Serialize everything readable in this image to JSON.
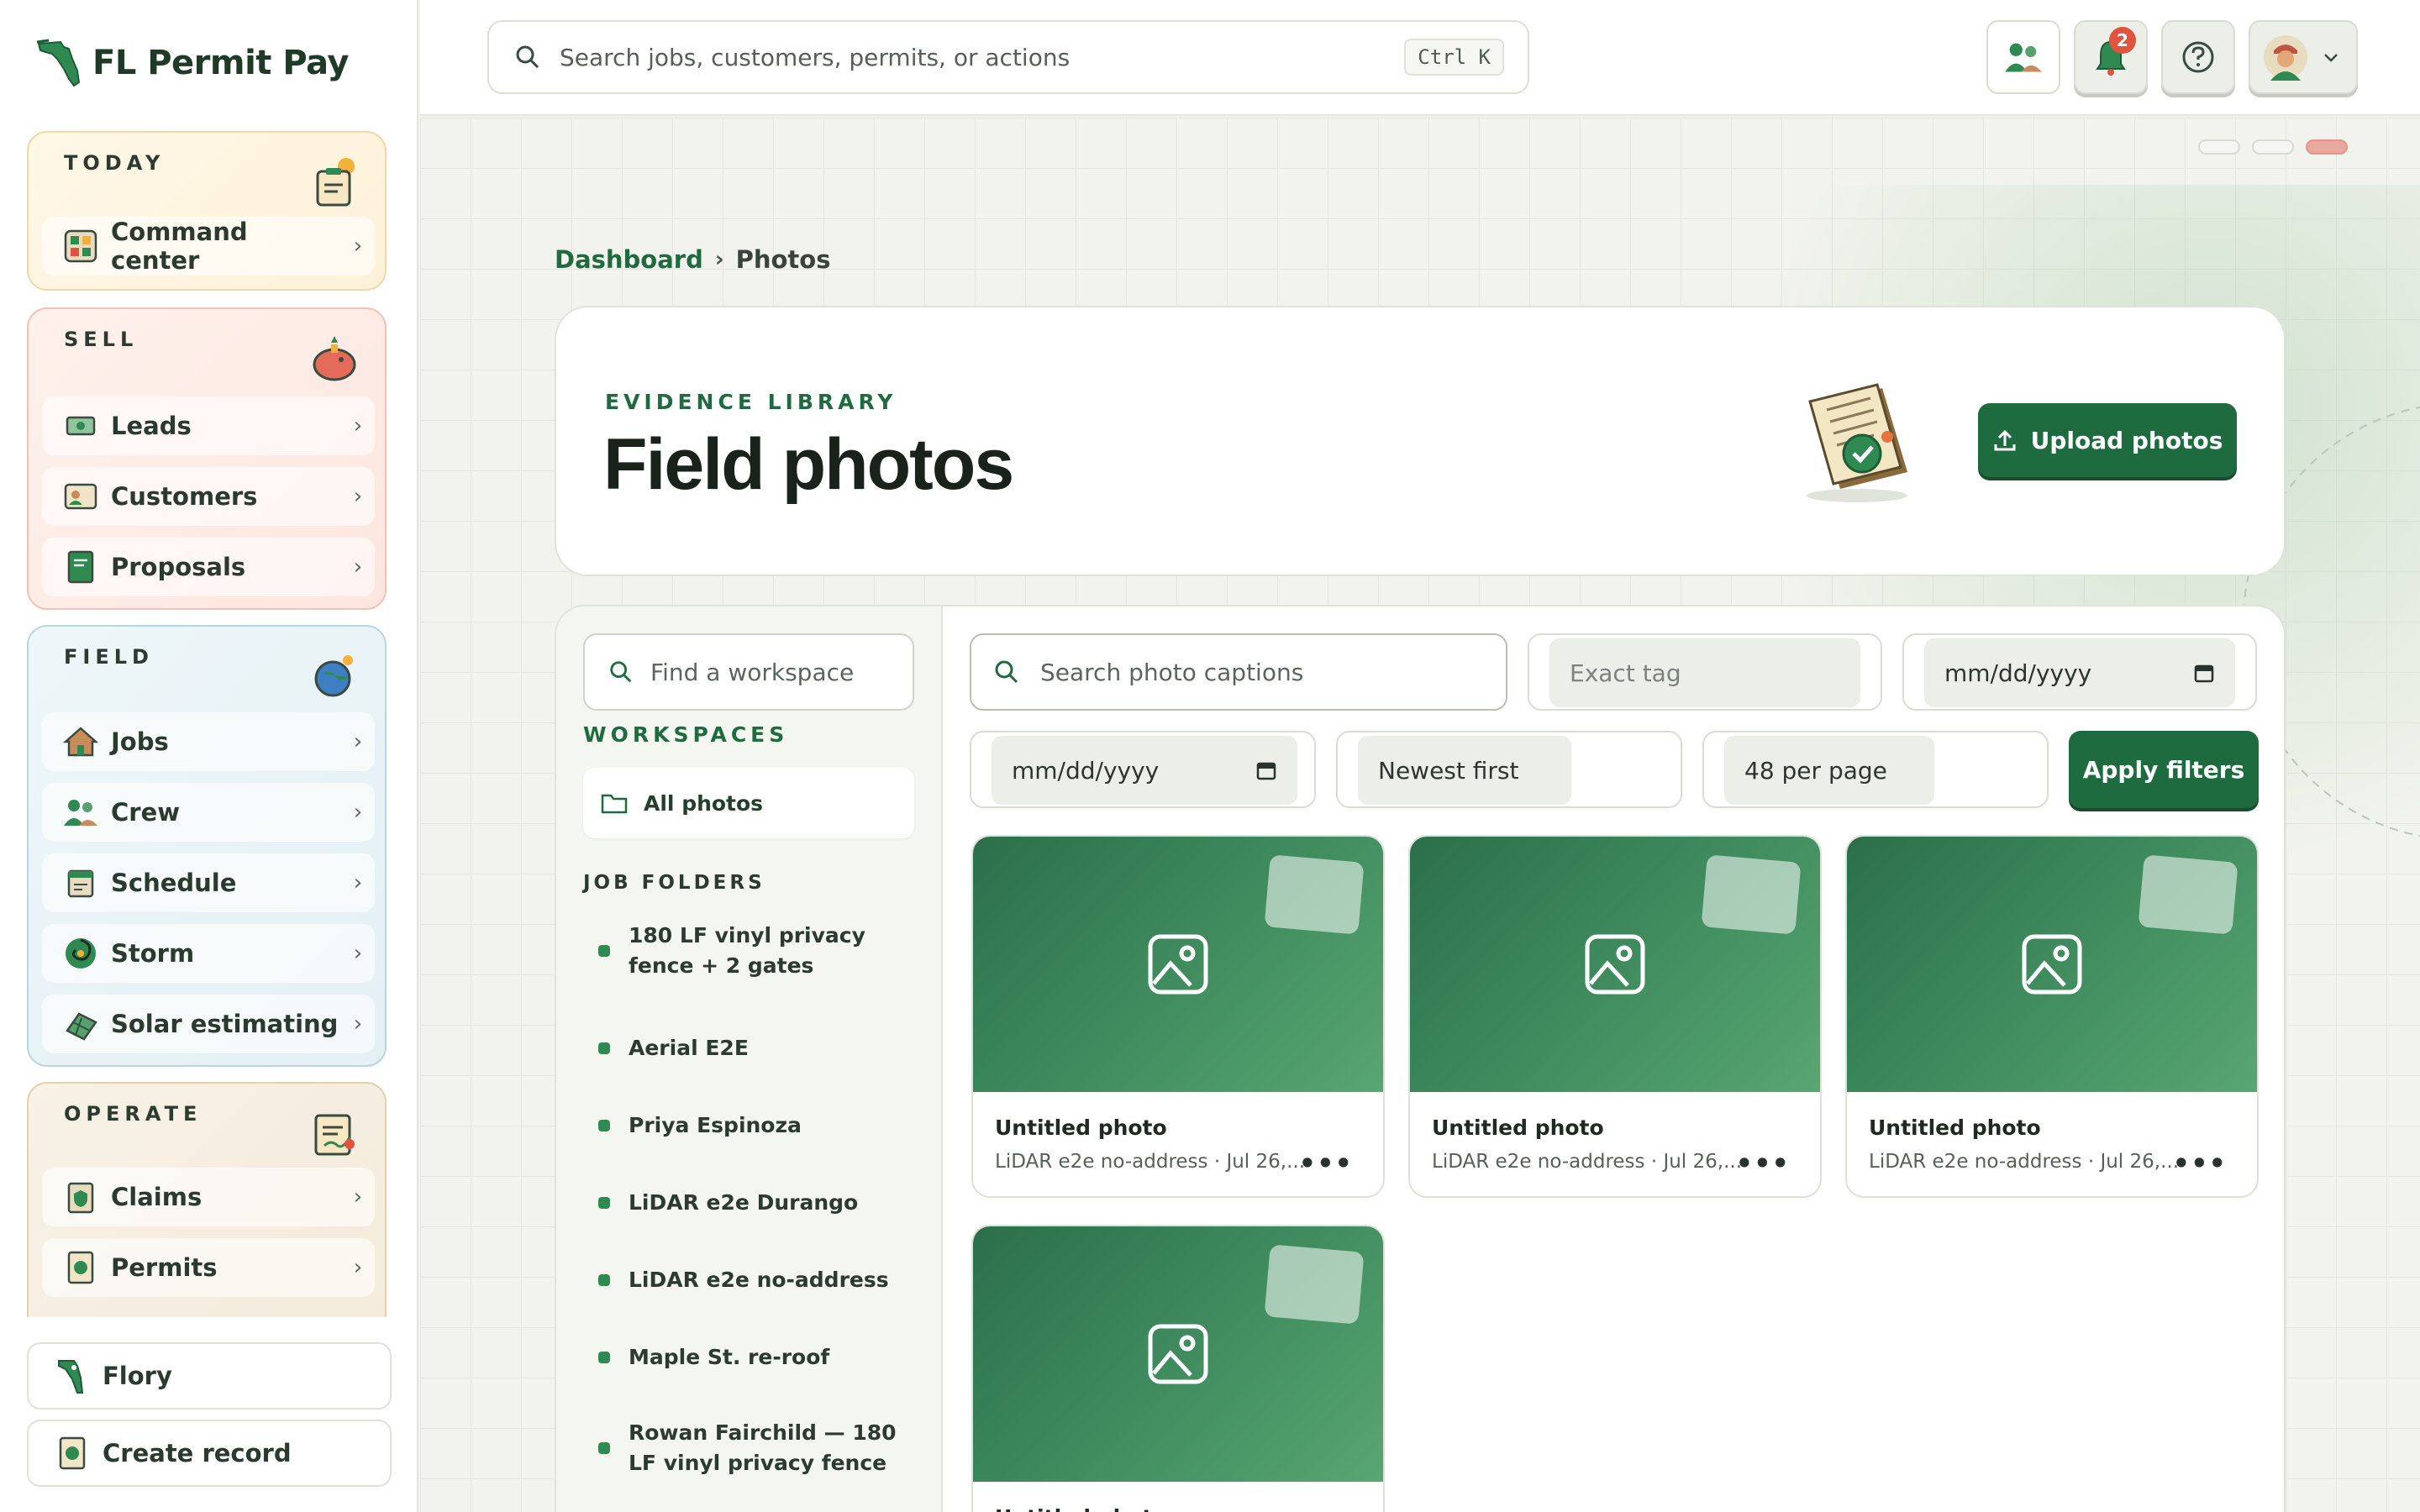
{
  "app": {
    "name": "FL Permit Pay"
  },
  "sidebar": {
    "sections": [
      {
        "title": "TODAY",
        "items": [
          {
            "label": "Command center"
          }
        ]
      },
      {
        "title": "SELL",
        "items": [
          {
            "label": "Leads"
          },
          {
            "label": "Customers"
          },
          {
            "label": "Proposals"
          }
        ]
      },
      {
        "title": "FIELD",
        "items": [
          {
            "label": "Jobs"
          },
          {
            "label": "Crew"
          },
          {
            "label": "Schedule"
          },
          {
            "label": "Storm"
          },
          {
            "label": "Solar estimating"
          }
        ]
      },
      {
        "title": "OPERATE",
        "items": [
          {
            "label": "Claims"
          },
          {
            "label": "Permits"
          }
        ]
      }
    ],
    "bottom": {
      "assistant": "Flory",
      "create": "Create record"
    }
  },
  "topbar": {
    "search_placeholder": "Search jobs, customers, permits, or actions",
    "shortcut": "Ctrl K",
    "notification_count": "2"
  },
  "breadcrumb": {
    "home": "Dashboard",
    "separator": "›",
    "current": "Photos"
  },
  "hero": {
    "eyebrow": "EVIDENCE LIBRARY",
    "title": "Field photos",
    "upload_label": "Upload photos"
  },
  "workspaces": {
    "search_placeholder": "Find a workspace",
    "heading": "WORKSPACES",
    "all_label": "All photos",
    "folders_heading": "JOB FOLDERS",
    "folders": [
      "180 LF vinyl privacy fence + 2 gates",
      "Aerial E2E",
      "Priya Espinoza",
      "LiDAR e2e Durango",
      "LiDAR e2e no-address",
      "Maple St. re-roof",
      "Rowan Fairchild — 180 LF vinyl privacy fence"
    ]
  },
  "filters": {
    "caption_placeholder": "Search photo captions",
    "tag_placeholder": "Exact tag",
    "date_from": "mm/dd/yyyy",
    "date_to": "mm/dd/yyyy",
    "sort": "Newest first",
    "per_page": "48 per page",
    "apply_label": "Apply filters"
  },
  "photos": [
    {
      "title": "Untitled photo",
      "subtitle": "LiDAR e2e no-address · Jul 26,..."
    },
    {
      "title": "Untitled photo",
      "subtitle": "LiDAR e2e no-address · Jul 26,..."
    },
    {
      "title": "Untitled photo",
      "subtitle": "LiDAR e2e no-address · Jul 26,..."
    },
    {
      "title": "Untitled photo",
      "subtitle": ""
    }
  ],
  "colors": {
    "brand": "#1f6b40",
    "accent_red": "#e0533f"
  }
}
